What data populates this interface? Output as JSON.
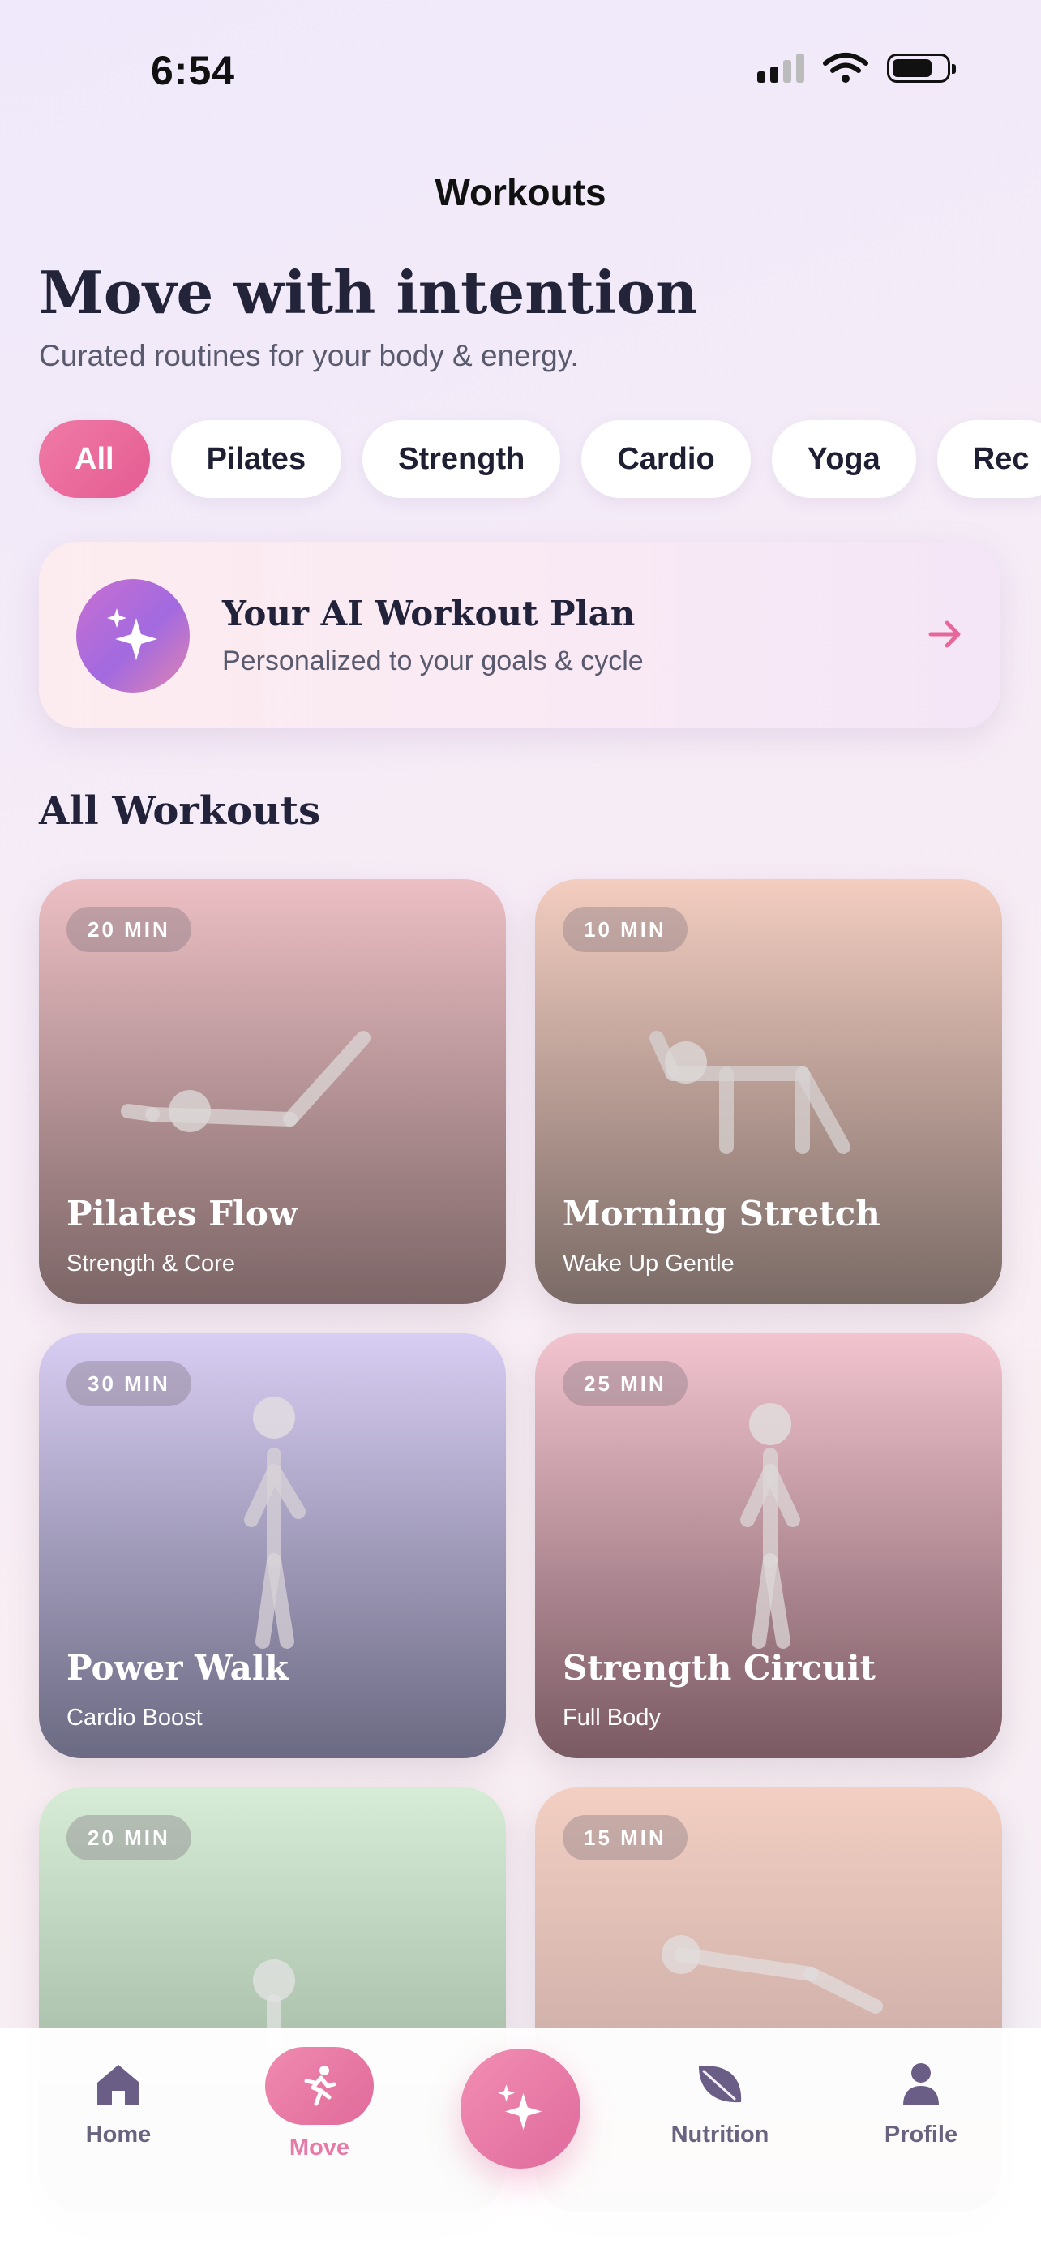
{
  "status_bar": {
    "time": "6:54"
  },
  "nav": {
    "title": "Workouts"
  },
  "header": {
    "headline": "Move with intention",
    "subtitle": "Curated routines for your body & energy."
  },
  "filters": {
    "chips": [
      "All",
      "Pilates",
      "Strength",
      "Cardio",
      "Yoga",
      "Rec"
    ],
    "selected": "All"
  },
  "ai_plan": {
    "title": "Your AI Workout Plan",
    "subtitle": "Personalized to your goals & cycle",
    "icon": "sparkles-icon",
    "arrow": "arrow-right-icon"
  },
  "section": {
    "title": "All Workouts"
  },
  "workouts": [
    {
      "duration": "20 MIN",
      "title": "Pilates Flow",
      "subtitle": "Strength & Core",
      "gradient": [
        "#ecbfc4",
        "#7c6566"
      ]
    },
    {
      "duration": "10 MIN",
      "title": "Morning Stretch",
      "subtitle": "Wake Up Gentle",
      "gradient": [
        "#f3cdc0",
        "#7a6a66"
      ]
    },
    {
      "duration": "30 MIN",
      "title": "Power Walk",
      "subtitle": "Cardio Boost",
      "gradient": [
        "#d8cdf3",
        "#6b6a82"
      ]
    },
    {
      "duration": "25 MIN",
      "title": "Strength Circuit",
      "subtitle": "Full Body",
      "gradient": [
        "#f2c4cf",
        "#7a5a63"
      ]
    },
    {
      "duration": "20 MIN",
      "title": "",
      "subtitle": "",
      "gradient": [
        "#d7ecd7",
        "#8fa58f"
      ]
    },
    {
      "duration": "15 MIN",
      "title": "",
      "subtitle": "",
      "gradient": [
        "#f3cfc2",
        "#b89c9a"
      ]
    }
  ],
  "tabbar": {
    "items": [
      {
        "label": "Home",
        "icon": "home-icon"
      },
      {
        "label": "Move",
        "icon": "running-icon"
      },
      {
        "label": "",
        "icon": "sparkles-icon"
      },
      {
        "label": "Nutrition",
        "icon": "leaf-icon"
      },
      {
        "label": "Profile",
        "icon": "person-icon"
      }
    ],
    "active": "Move"
  },
  "colors": {
    "accent": "#e8679b",
    "text": "#22233a"
  }
}
